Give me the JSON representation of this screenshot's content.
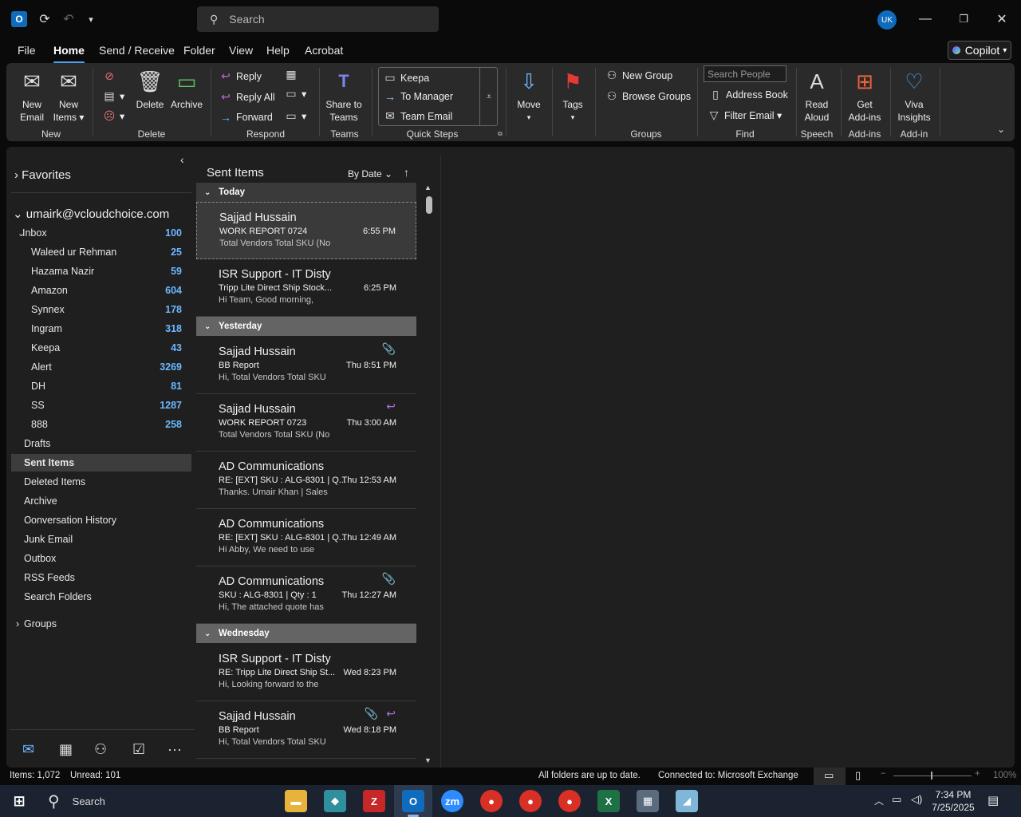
{
  "titlebar": {
    "search_placeholder": "Search",
    "avatar_initials": "UK",
    "app_letter": "O"
  },
  "menu": {
    "tabs": [
      "File",
      "Home",
      "Send / Receive",
      "Folder",
      "View",
      "Help",
      "Acrobat"
    ],
    "active": "Home",
    "copilot_label": "Copilot"
  },
  "ribbon": {
    "new_email": [
      "New",
      "Email"
    ],
    "new_items": [
      "New",
      "Items"
    ],
    "delete": "Delete",
    "archive": "Archive",
    "reply": "Reply",
    "reply_all": "Reply All",
    "forward": "Forward",
    "share_teams": [
      "Share to",
      "Teams"
    ],
    "quick_steps": [
      "Keepa",
      "To Manager",
      "Team Email"
    ],
    "move": "Move",
    "tags": "Tags",
    "new_group": "New Group",
    "browse_groups": "Browse Groups",
    "search_people_placeholder": "Search People",
    "address_book": "Address Book",
    "filter_email": "Filter Email",
    "read_aloud": [
      "Read",
      "Aloud"
    ],
    "get_addins": [
      "Get",
      "Add-ins"
    ],
    "viva": [
      "Viva",
      "Insights"
    ],
    "groups": {
      "new": "New",
      "delete": "Delete",
      "respond": "Respond",
      "teams": "Teams",
      "quick_steps": "Quick Steps",
      "groups": "Groups",
      "find": "Find",
      "speech": "Speech",
      "addins": "Add-ins",
      "addin": "Add-in"
    }
  },
  "nav": {
    "favorites": "Favorites",
    "account": "umairk@vcloudchoice.com",
    "inbox": {
      "label": "Inbox",
      "count": "100"
    },
    "subfolders": [
      {
        "label": "Waleed ur Rehman",
        "count": "25"
      },
      {
        "label": "Hazama Nazir",
        "count": "59"
      },
      {
        "label": "Amazon",
        "count": "604"
      },
      {
        "label": "Synnex",
        "count": "178"
      },
      {
        "label": "Ingram",
        "count": "318"
      },
      {
        "label": "Keepa",
        "count": "43"
      },
      {
        "label": "Alert",
        "count": "3269"
      },
      {
        "label": "DH",
        "count": "81"
      },
      {
        "label": "SS",
        "count": "1287"
      },
      {
        "label": "888",
        "count": "258"
      }
    ],
    "folders": [
      "Drafts",
      "Sent Items",
      "Deleted Items",
      "Archive",
      "Conversation History",
      "Junk Email",
      "Outbox",
      "RSS Feeds",
      "Search Folders"
    ],
    "selected_folder": "Sent Items",
    "groups": "Groups"
  },
  "list": {
    "title": "Sent Items",
    "sort": "By Date",
    "groups": [
      "Today",
      "Yesterday",
      "Wednesday"
    ],
    "messages": [
      {
        "from": "Sajjad Hussain",
        "subject": "WORK REPORT 0724",
        "time": "6:55 PM",
        "preview": "Total Vendors  Total SKU (No",
        "icon": ""
      },
      {
        "from": "ISR Support - IT Disty",
        "subject": "Tripp Lite Direct Ship Stock...",
        "time": "6:25 PM",
        "preview": "Hi Team,  Good morning,",
        "icon": ""
      },
      {
        "from": "Sajjad Hussain",
        "subject": "BB Report",
        "time": "Thu 8:51 PM",
        "preview": "Hi,  Total Vendors  Total SKU",
        "icon": "attachment"
      },
      {
        "from": "Sajjad Hussain",
        "subject": "WORK REPORT 0723",
        "time": "Thu 3:00 AM",
        "preview": "Total Vendors  Total SKU (No",
        "icon": "replied"
      },
      {
        "from": "AD Communications",
        "subject": "RE: [EXT] SKU : ALG-8301 | Q...",
        "time": "Thu 12:53 AM",
        "preview": "Thanks.  Umair Khan | Sales",
        "icon": ""
      },
      {
        "from": "AD Communications",
        "subject": "RE: [EXT] SKU : ALG-8301 | Q...",
        "time": "Thu 12:49 AM",
        "preview": "Hi Abby,  We need to use",
        "icon": ""
      },
      {
        "from": "AD Communications",
        "subject": "SKU : ALG-8301 | Qty : 1",
        "time": "Thu 12:27 AM",
        "preview": "Hi,  The attached quote has",
        "icon": "attachment"
      },
      {
        "from": "ISR Support - IT Disty",
        "subject": "RE: Tripp Lite Direct Ship St...",
        "time": "Wed 8:23 PM",
        "preview": "Hi,  Looking forward to the",
        "icon": ""
      },
      {
        "from": "Sajjad Hussain",
        "subject": "BB Report",
        "time": "Wed 8:18 PM",
        "preview": "Hi,  Total Vendors  Total SKU",
        "icon": "attachment-replied"
      }
    ]
  },
  "status": {
    "items": "Items: 1,072",
    "unread": "Unread: 101",
    "sync": "All folders are up to date.",
    "connection": "Connected to: Microsoft Exchange",
    "zoom": "100%"
  },
  "taskbar": {
    "search_label": "Search",
    "time": "7:34 PM",
    "date": "7/25/2025"
  }
}
